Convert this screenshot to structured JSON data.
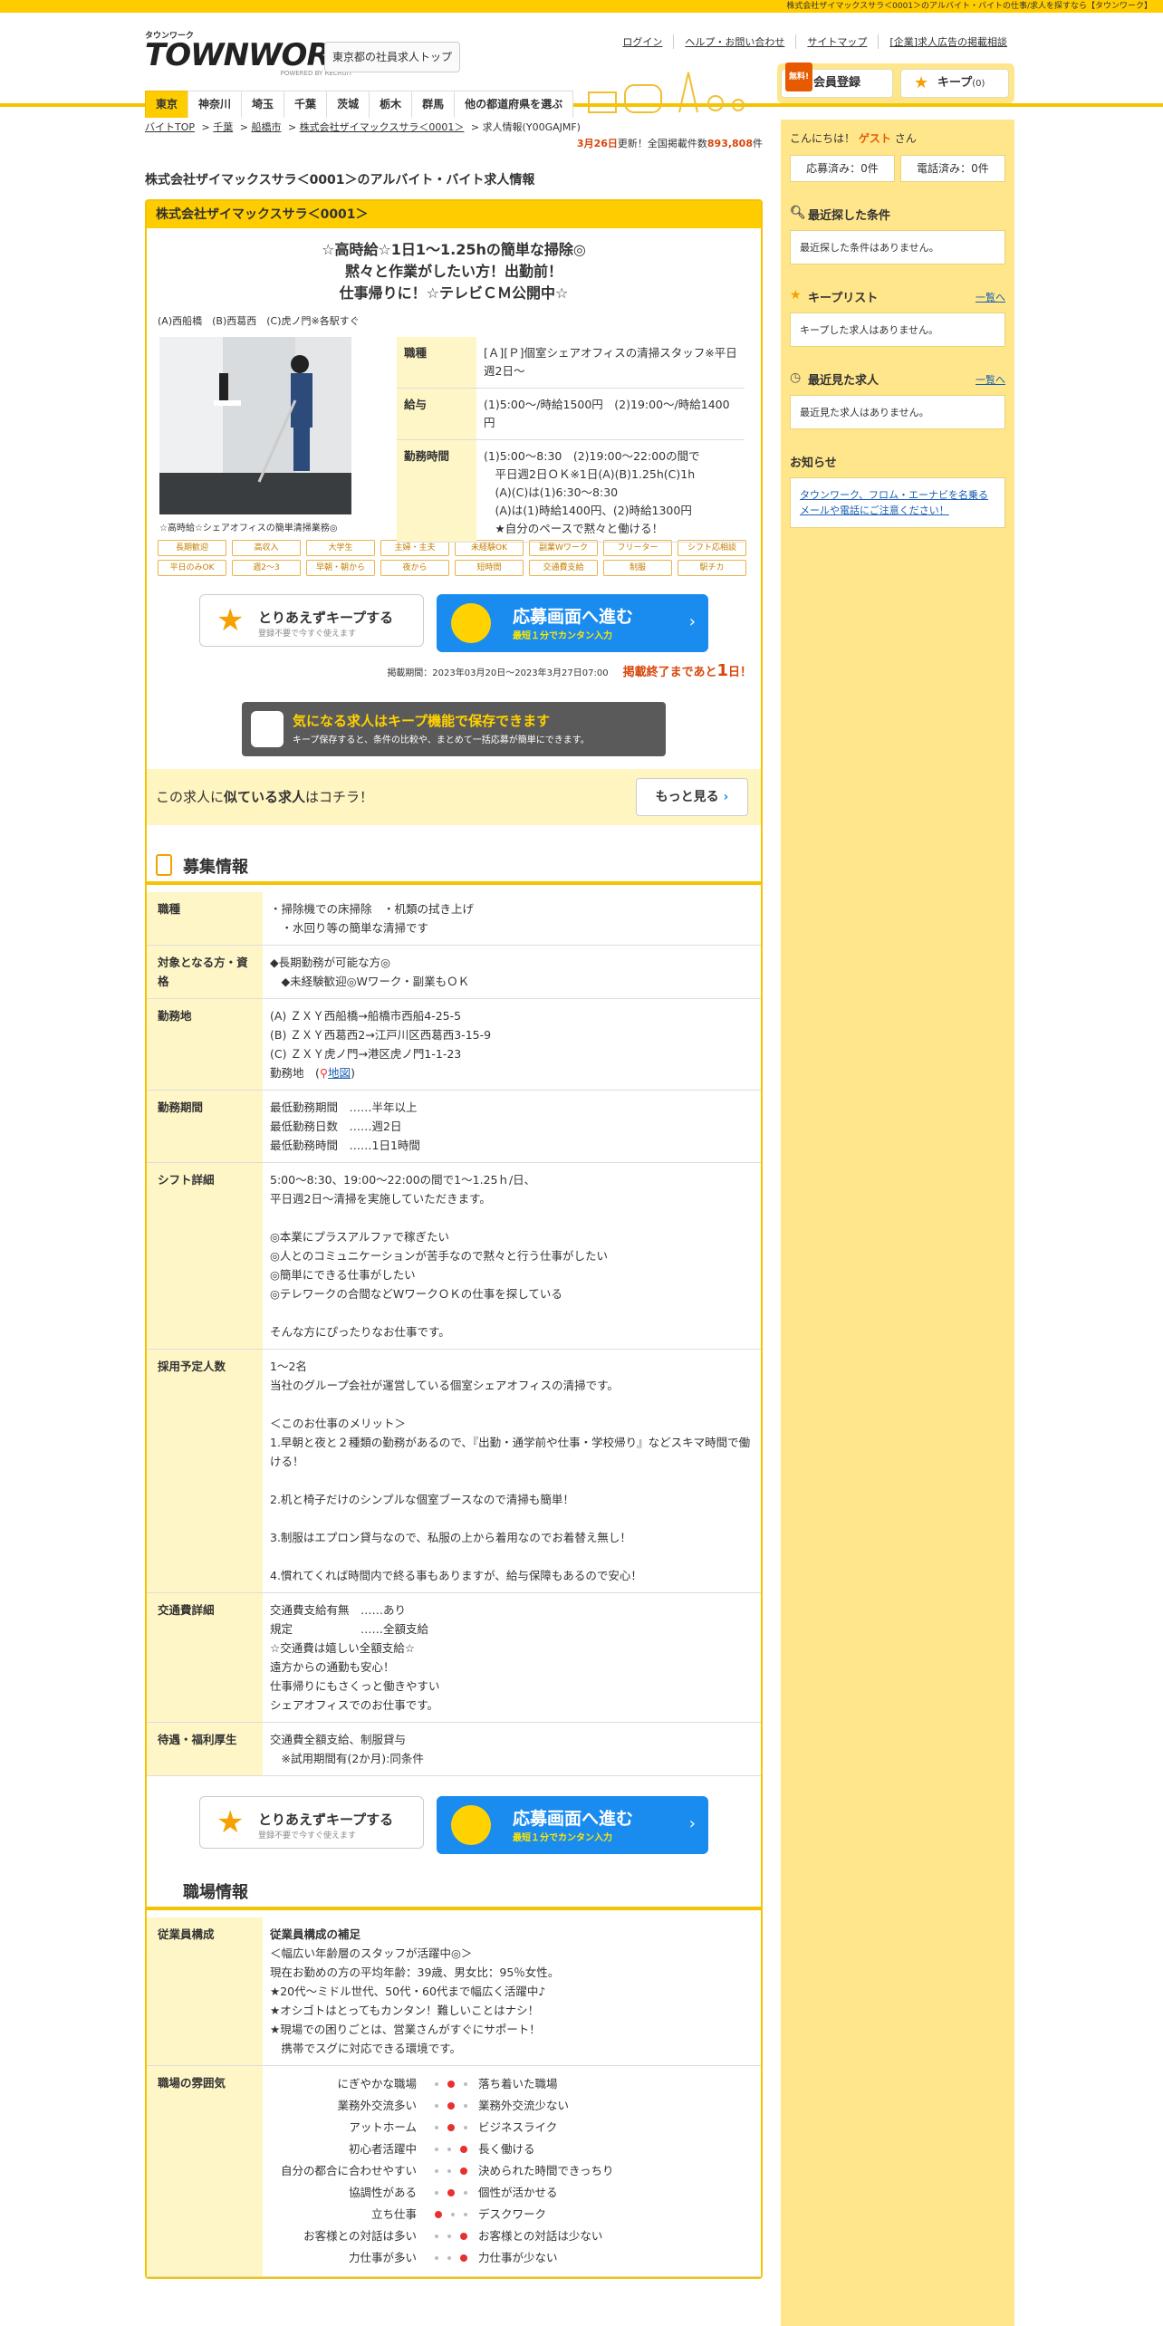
{
  "topbar": "株式会社ザイマックスサラ＜0001＞のアルバイト・バイトの仕事/求人を探すなら【タウンワーク】",
  "header": {
    "logo_small": "タウンワーク",
    "logo_big": "TOWNWORK",
    "logo_powered": "POWERED BY RECRUIT",
    "regular_top": "東京都の社員求人トップ",
    "links": [
      "ログイン",
      "ヘルプ・お問い合わせ",
      "サイトマップ",
      "[企業]求人広告の掲載相談"
    ],
    "prefs": [
      "東京",
      "神奈川",
      "埼玉",
      "千葉",
      "茨城",
      "栃木",
      "群馬",
      "他の都道府県を選ぶ"
    ],
    "free": "無料!",
    "member": "会員登録",
    "keep": "キープ",
    "keep_count": "(0)"
  },
  "crumbs": [
    "バイトTOP",
    "千葉",
    "船橋市",
    "株式会社ザイマックスサラ＜0001＞",
    "求人情報(Y00GAJMF)"
  ],
  "update": {
    "date": "3月26日",
    "text": "更新！全国掲載件数",
    "count": "893,808",
    "unit": "件"
  },
  "page_title": "株式会社ザイマックスサラ＜0001＞のアルバイト・バイト求人情報",
  "card": {
    "company": "株式会社ザイマックスサラ＜0001＞",
    "catch": [
      "☆高時給☆1日1～1.25hの簡単な掃除◎",
      "黙々と作業がしたい方！出勤前！",
      "仕事帰りに！☆テレビＣＭ公開中☆"
    ],
    "stations": "(A)西船橋　(B)西葛西　(C)虎ノ門※各駅すぐ",
    "caption": "☆高時給☆シェアオフィスの簡単清掃業務◎",
    "summary": [
      {
        "k": "職種",
        "v": "[Ａ][Ｐ]個室シェアオフィスの清掃スタッフ※平日週2日～"
      },
      {
        "k": "給与",
        "v": "(1)5:00～/時給1500円　(2)19:00～/時給1400円"
      },
      {
        "k": "勤務時間",
        "lines": [
          "(1)5:00～8:30　(2)19:00～22:00の間で",
          "　平日週2日ＯＫ※1日(A)(B)1.25h(C)1h",
          "　(A)(C)は(1)6:30～8:30",
          "　(A)は(1)時給1400円、(2)時給1300円",
          "　★自分のペースで黙々と働ける！"
        ]
      }
    ],
    "tags": [
      "長期歓迎",
      "高収入",
      "大学生",
      "主婦・主夫",
      "未経験OK",
      "副業Wワーク",
      "フリーター",
      "シフト応相談",
      "平日のみOK",
      "週2～3",
      "早朝・朝から",
      "夜から",
      "短時間",
      "交通費支給",
      "制服",
      "駅チカ"
    ],
    "keep_btn": {
      "t": "とりあえずキープする",
      "s": "登録不要で今すぐ使えます"
    },
    "apply_btn": {
      "t": "応募画面へ進む",
      "s": "最短１分でカンタン入力"
    },
    "period": "掲載期間：2023年03月20日～2023年3月27日07:00",
    "deadline_pre": "掲載終了まであと",
    "deadline_num": "1",
    "deadline_post": "日！",
    "keep_promo": {
      "t": "気になる求人はキープ機能で保存できます",
      "s": "キープ保存すると、条件の比較や、まとめて一括応募が簡単にできます。"
    },
    "similar": {
      "pre": "この求人に",
      "b": "似ている求人",
      "post": "はコチラ！",
      "more": "もっと見る"
    }
  },
  "recruit": {
    "title": "募集情報",
    "rows": [
      {
        "k": "職種",
        "lines": [
          "・掃除機での床掃除　・机類の拭き上げ",
          "　・水回り等の簡単な清掃です"
        ]
      },
      {
        "k": "対象となる方・資格",
        "lines": [
          "◆長期勤務が可能な方◎",
          "　◆未経験歓迎◎Wワーク・副業もＯＫ"
        ]
      },
      {
        "k": "勤務地",
        "lines": [
          "(A) ＺＸＹ西船橋→船橋市西船4-25-5",
          "(B) ＺＸＹ西葛西2→江戸川区西葛西3-15-9",
          "(C) ＺＸＹ虎ノ門→港区虎ノ門1-1-23"
        ],
        "map_pre": "勤務地　(",
        "map": "地図",
        "map_post": ")"
      },
      {
        "k": "勤務期間",
        "lines": [
          "最低勤務期間　……半年以上",
          "最低勤務日数　……週2日",
          "最低勤務時間　……1日1時間"
        ]
      },
      {
        "k": "シフト詳細",
        "lines": [
          "5:00～8:30、19:00～22:00の間で1～1.25ｈ/日、",
          "平日週2日～清掃を実施していただきます。",
          "",
          "◎本業にプラスアルファで稼ぎたい",
          "◎人とのコミュニケーションが苦手なので黙々と行う仕事がしたい",
          "◎簡単にできる仕事がしたい",
          "◎テレワークの合間などWワークＯＫの仕事を探している",
          "",
          "そんな方にぴったりなお仕事です。"
        ]
      },
      {
        "k": "採用予定人数",
        "lines": [
          "1～2名",
          "当社のグループ会社が運営している個室シェアオフィスの清掃です。",
          "",
          "＜このお仕事のメリット＞",
          "1.早朝と夜と２種類の勤務があるので、『出勤・通学前や仕事・学校帰り』などスキマ時間で働ける！",
          "",
          "2.机と椅子だけのシンプルな個室ブースなので清掃も簡単！",
          "",
          "3.制服はエプロン貸与なので、私服の上から着用なのでお着替え無し！",
          "",
          "4.慣れてくれば時間内で終る事もありますが、給与保障もあるので安心！"
        ]
      },
      {
        "k": "交通費詳細",
        "lines": [
          "交通費支給有無　……あり",
          "規定　　　　　　……全額支給",
          "☆交通費は嬉しい全額支給☆",
          "遠方からの通勤も安心！",
          "仕事帰りにもさくっと働きやすい",
          "シェアオフィスでのお仕事です。"
        ]
      },
      {
        "k": "待遇・福利厚生",
        "lines": [
          "交通費全額支給、制服貸与",
          "　※試用期間有(2か月):同条件"
        ]
      }
    ]
  },
  "workplace": {
    "title": "職場情報",
    "staff_k": "従業員構成",
    "staff_title": "従業員構成の補足",
    "staff_lines": [
      "＜幅広い年齢層のスタッフが活躍中◎＞",
      "現在お勤めの方の平均年齢：39歳、男女比：95％女性。",
      "★20代～ミドル世代、50代・60代まで幅広く活躍中♪",
      "★オシゴトはとってもカンタン！難しいことはナシ！",
      "★現場での困りごとは、営業さんがすぐにサポート！",
      "　携帯でスグに対応できる環境です。"
    ],
    "atm_k": "職場の雰囲気",
    "atmosphere": [
      {
        "l": "にぎやかな職場",
        "r": "落ち着いた職場",
        "pos": 1
      },
      {
        "l": "業務外交流多い",
        "r": "業務外交流少ない",
        "pos": 1
      },
      {
        "l": "アットホーム",
        "r": "ビジネスライク",
        "pos": 1
      },
      {
        "l": "初心者活躍中",
        "r": "長く働ける",
        "pos": 2
      },
      {
        "l": "自分の都合に合わせやすい",
        "r": "決められた時間できっちり",
        "pos": 2
      },
      {
        "l": "協調性がある",
        "r": "個性が活かせる",
        "pos": 1
      },
      {
        "l": "立ち仕事",
        "r": "デスクワーク",
        "pos": 0
      },
      {
        "l": "お客様との対話は多い",
        "r": "お客様との対話は少ない",
        "pos": 2
      },
      {
        "l": "力仕事が多い",
        "r": "力仕事が少ない",
        "pos": 2
      }
    ]
  },
  "side": {
    "hello_pre": "こんにちは！",
    "guest": "ゲスト",
    "hello_post": "さん",
    "applied": "応募済み：0件",
    "called": "電話済み：0件",
    "recent_cond": "最近探した条件",
    "recent_cond_empty": "最近探した条件はありません。",
    "keep_list": "キープリスト",
    "keep_empty": "キープした求人はありません。",
    "recent_view": "最近見た求人",
    "recent_view_empty": "最近見た求人はありません。",
    "list_link": "一覧へ",
    "notice": "お知らせ",
    "notice_text": "タウンワーク、フロム・エーナビを名乗るメールや電話にご注意ください！"
  }
}
